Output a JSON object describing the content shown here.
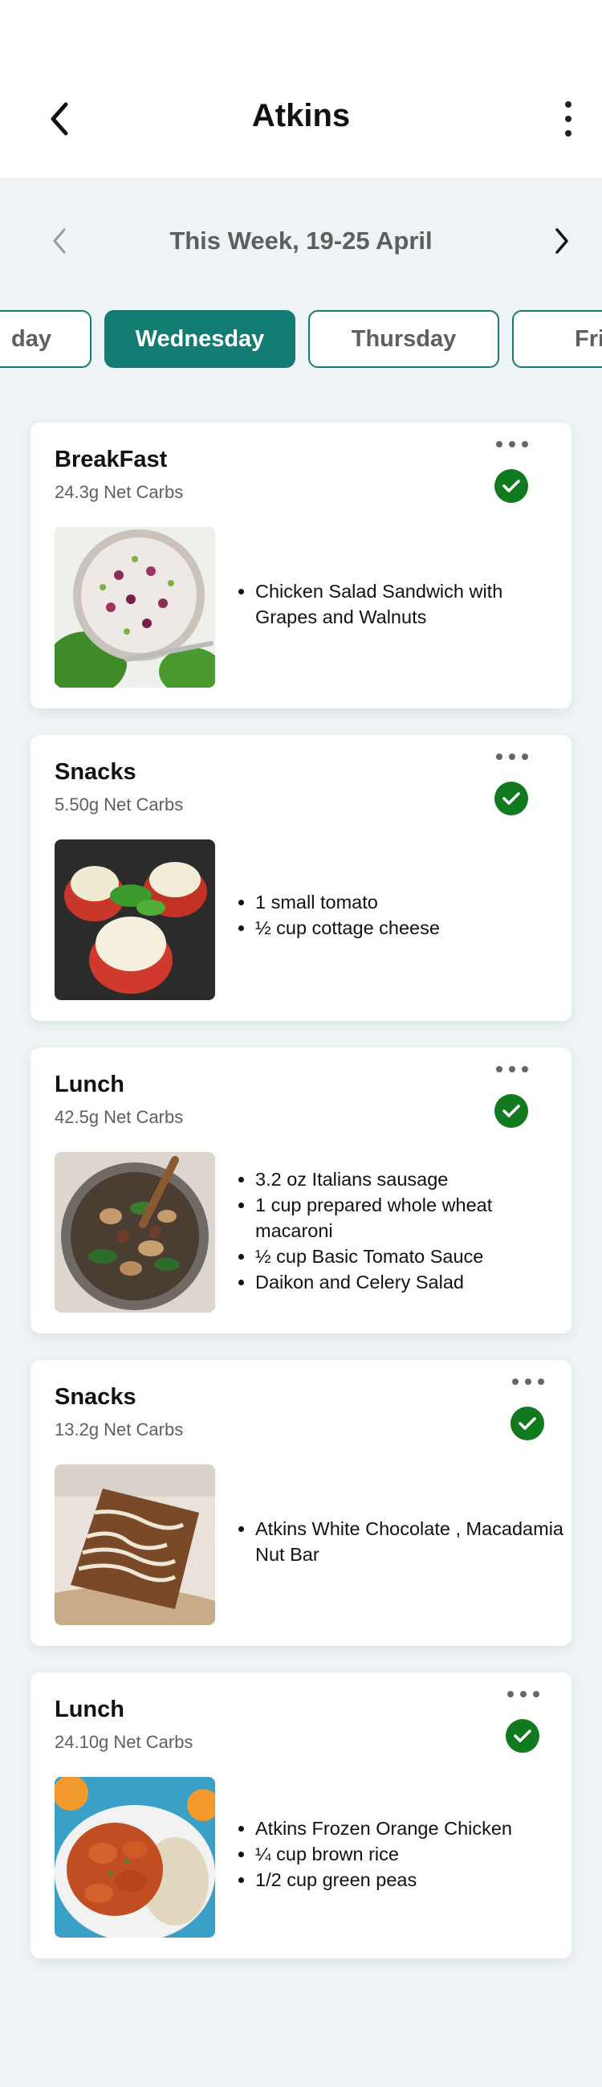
{
  "header": {
    "title": "Atkins",
    "back_icon": "chevron-left-icon",
    "more_icon": "more-vertical-icon"
  },
  "week": {
    "label": "This Week, 19-25 April",
    "prev_icon": "chevron-left-icon",
    "next_icon": "chevron-right-icon"
  },
  "day_tabs": [
    {
      "label": "day",
      "active": false
    },
    {
      "label": "Wednesday",
      "active": true
    },
    {
      "label": "Thursday",
      "active": false
    },
    {
      "label": "Fri",
      "active": false
    }
  ],
  "meals": [
    {
      "title": "BreakFast",
      "carbs": "24.3g Net Carbs",
      "items": [
        "Chicken Salad Sandwich with Grapes and Walnuts"
      ],
      "done": true
    },
    {
      "title": "Snacks",
      "carbs": "5.50g Net Carbs",
      "items": [
        "1 small tomato",
        "½ cup cottage cheese"
      ],
      "done": true
    },
    {
      "title": "Lunch",
      "carbs": "42.5g Net Carbs",
      "items": [
        "3.2 oz Italians sausage",
        " 1 cup prepared whole wheat macaroni",
        "½ cup Basic Tomato Sauce",
        "Daikon and Celery Salad"
      ],
      "done": true
    },
    {
      "title": "Snacks",
      "carbs": "13.2g Net Carbs",
      "items": [
        "Atkins White Chocolate , Macadamia Nut Bar"
      ],
      "done": true
    },
    {
      "title": "Lunch",
      "carbs": "24.10g Net Carbs",
      "items": [
        "Atkins Frozen Orange Chicken",
        "¼ cup brown rice",
        "1/2 cup green peas"
      ],
      "done": true
    }
  ],
  "colors": {
    "accent": "#137c72",
    "check": "#117a1e",
    "background": "#eef4f6"
  }
}
